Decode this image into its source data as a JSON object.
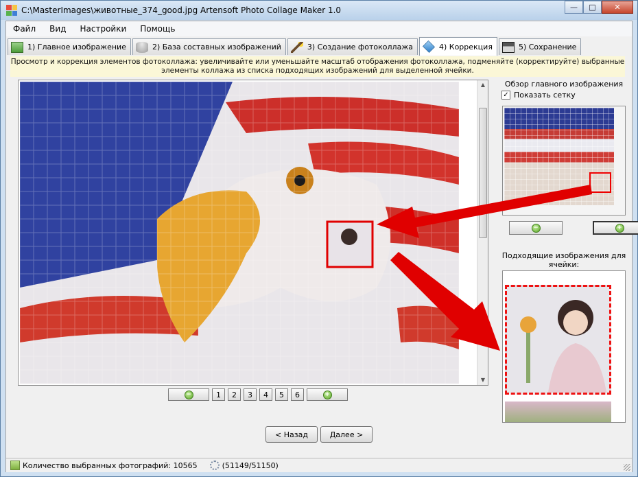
{
  "window": {
    "title": "C:\\MasterImages\\животные_374_good.jpg Artensoft Photo Collage Maker 1.0",
    "minimize_glyph": "—",
    "maximize_glyph": "□",
    "close_glyph": "✕"
  },
  "menu": [
    "Файл",
    "Вид",
    "Настройки",
    "Помощь"
  ],
  "tabs": [
    {
      "label": "1) Главное изображение",
      "icon": "main-image-icon"
    },
    {
      "label": "2) База составных изображений",
      "icon": "database-icon"
    },
    {
      "label": "3) Создание фотоколлажа",
      "icon": "magic-wand-icon"
    },
    {
      "label": "4) Коррекция",
      "icon": "cube-icon",
      "active": true
    },
    {
      "label": "5) Сохранение",
      "icon": "floppy-disk-icon"
    }
  ],
  "info_text": "Просмотр и коррекция элементов фотоколлажа: увеличивайте или уменьшайте масштаб отображения фотоколлажа, подменяйте (корректируйте) выбранные элементы коллажа из списка подходящих изображений для выделенной ячейки.",
  "pager": {
    "zoom_out_glyph": "−",
    "zoom_in_glyph": "+",
    "pages": [
      "1",
      "2",
      "3",
      "4",
      "5",
      "6"
    ]
  },
  "right_panel": {
    "overview_title": "Обзор главного изображения",
    "show_grid_label": "Показать сетку",
    "show_grid_checked": true,
    "matching_title": "Подходящие изображения для ячейки:"
  },
  "nav": {
    "back_label": "< Назад",
    "next_label": "Далее >"
  },
  "status": {
    "selected_count_text": "Количество выбранных фотографий: 10565",
    "progress_text": "(51149/51150)"
  },
  "colors": {
    "highlight_red": "#e00000",
    "info_bg": "#fbf7d7",
    "flag_blue": "#2b3d9d",
    "flag_red": "#c8302b"
  }
}
